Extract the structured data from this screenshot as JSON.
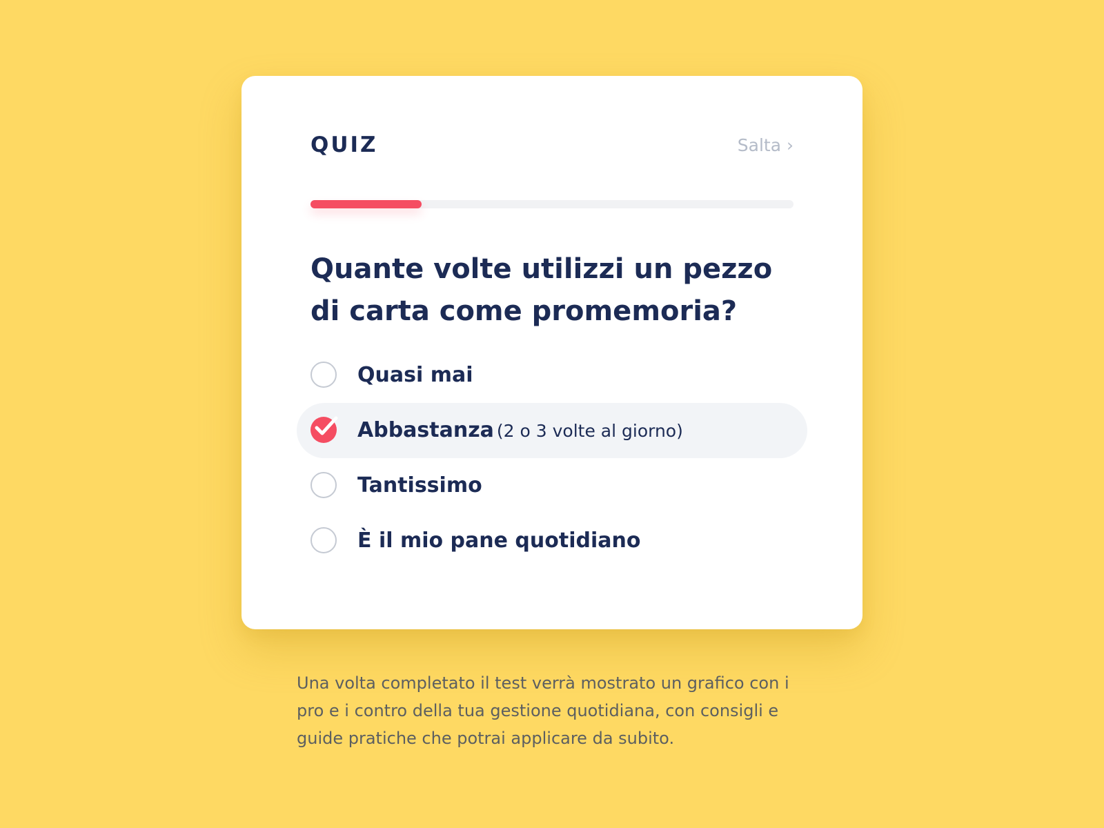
{
  "quiz": {
    "title": "QUIZ",
    "skip_label": "Salta ›",
    "progress": 0.23,
    "question": "Quante volte utilizzi un pezzo di carta come promemoria?",
    "options": [
      {
        "label": "Quasi mai",
        "note": "",
        "selected": false
      },
      {
        "label": "Abbastanza",
        "note": "(2 o 3 volte al giorno)",
        "selected": true
      },
      {
        "label": "Tantissimo",
        "note": "",
        "selected": false
      },
      {
        "label": "È il mio pane quotidiano",
        "note": "",
        "selected": false
      }
    ]
  },
  "footer": {
    "text": "Una volta completato il test verrà mostrato un grafico con i pro e i contro della tua gestione quotidiana, con consigli e guide pratiche che potrai applicare da subito."
  },
  "colors": {
    "background": "#FED963",
    "accent": "#F54D62",
    "text_primary": "#1C2B55",
    "text_muted": "#B4BBC8"
  },
  "icons": {
    "checked": "check-icon"
  }
}
